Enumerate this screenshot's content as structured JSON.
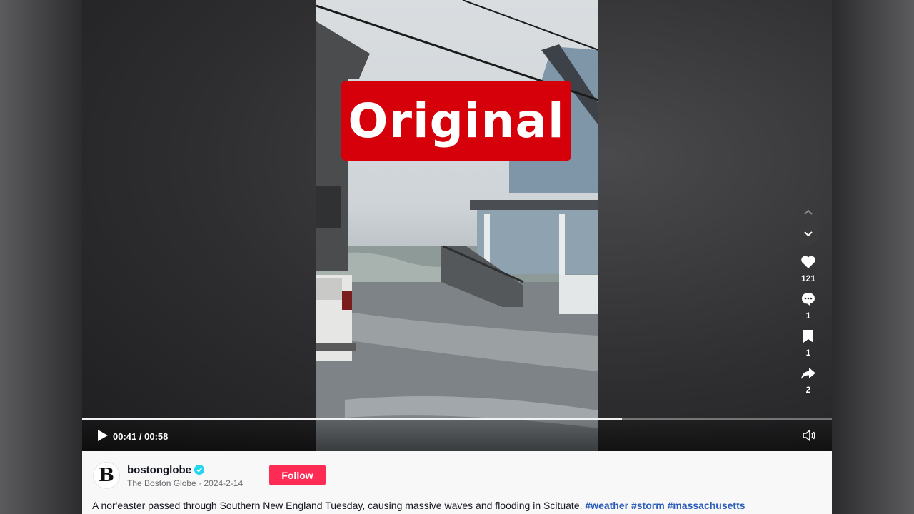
{
  "overlay": {
    "label": "Original",
    "color": "#d6000b"
  },
  "player": {
    "current_time": "00:41",
    "duration": "00:58",
    "progress_fraction": 0.72,
    "play_icon": "play-icon",
    "volume_icon": "volume-icon"
  },
  "actions": {
    "likes": "121",
    "comments": "1",
    "saves": "1",
    "shares": "2"
  },
  "post": {
    "avatar_letter": "B",
    "username": "bostonglobe",
    "display_name": "The Boston Globe",
    "date": "2024-2-14",
    "follow_label": "Follow",
    "caption": "A nor'easter passed through Southern New England Tuesday, causing massive waves and flooding in Scituate.",
    "hashtags": [
      "#weather",
      "#storm",
      "#massachusetts"
    ],
    "accent_color": "#fe2c55"
  }
}
